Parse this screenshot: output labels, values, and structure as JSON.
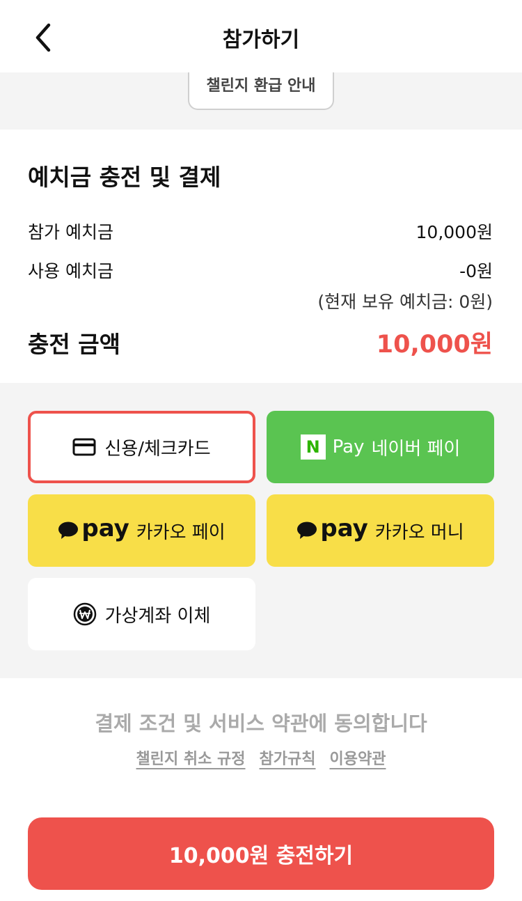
{
  "header": {
    "title": "참가하기",
    "back_icon": "chevron-left-icon"
  },
  "refund_info": {
    "label": "챌린지 환급 안내"
  },
  "deposit": {
    "title": "예치금 충전 및 결제",
    "rows": [
      {
        "label": "참가 예치금",
        "value": "10,000원"
      },
      {
        "label": "사용 예치금",
        "value": "-0원"
      }
    ],
    "balance_note": "(현재 보유 예치금: 0원)",
    "total_label": "충전 금액",
    "total_value": "10,000원",
    "accent_color": "#ee524c"
  },
  "payment_methods": {
    "credit_card": {
      "label": "신용/체크카드",
      "icon": "credit-card-icon",
      "selected": true
    },
    "naver_pay": {
      "logo_letter": "N",
      "pay_word": "Pay",
      "label": "네이버 페이",
      "color": "#5ac451"
    },
    "kakao_pay": {
      "logo_text": "pay",
      "label": "카카오 페이",
      "color": "#f8de48"
    },
    "kakao_money": {
      "logo_text": "pay",
      "label": "카카오 머니",
      "color": "#f8de48"
    },
    "virtual_account": {
      "label": "가상계좌 이체",
      "icon": "won-coin-icon"
    }
  },
  "agreement": {
    "text": "결제 조건 및 서비스 약관에 동의합니다",
    "links": [
      "챌린지 취소 규정",
      "참가규칙",
      "이용약관"
    ]
  },
  "submit": {
    "label": "10,000원 충전하기",
    "color": "#ee524c"
  }
}
